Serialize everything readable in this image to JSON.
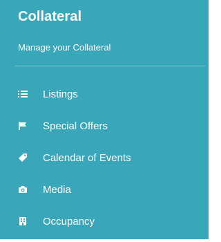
{
  "panel": {
    "title": "Collateral",
    "subtitle": "Manage your Collateral",
    "background_color": "#3aa6b9",
    "text_color": "#ffffff"
  },
  "menu": {
    "items": [
      {
        "label": "Listings",
        "icon": "list-icon"
      },
      {
        "label": "Special Offers",
        "icon": "flag-icon"
      },
      {
        "label": "Calendar of Events",
        "icon": "tag-icon"
      },
      {
        "label": "Media",
        "icon": "camera-icon"
      },
      {
        "label": "Occupancy",
        "icon": "building-icon"
      }
    ]
  }
}
